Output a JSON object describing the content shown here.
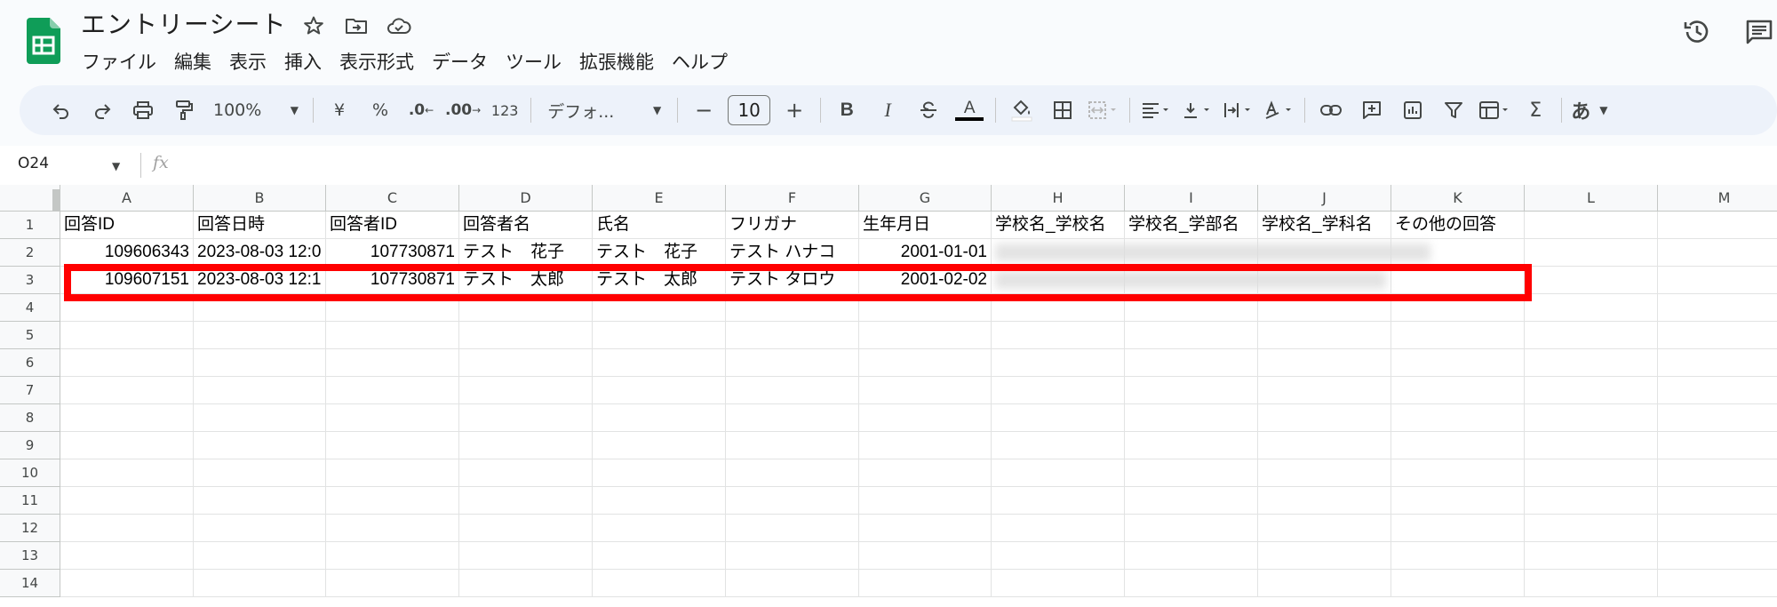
{
  "app": {
    "doc_title": "エントリーシート"
  },
  "menu": [
    "ファイル",
    "編集",
    "表示",
    "挿入",
    "表示形式",
    "データ",
    "ツール",
    "拡張機能",
    "ヘルプ"
  ],
  "toolbar": {
    "zoom": "100%",
    "currency": "¥",
    "percent": "%",
    "dec_decrease": ".0",
    "dec_increase": ".00",
    "number_format": "123",
    "font": "デフォ...",
    "font_size": "10",
    "minus": "−",
    "plus": "+",
    "bold": "B",
    "italic": "I",
    "text_color": "A",
    "input_tools": "あ",
    "sigma": "Σ"
  },
  "formula_bar": {
    "cell_ref": "O24",
    "fx": "fx",
    "content": ""
  },
  "grid": {
    "columns": [
      "A",
      "B",
      "C",
      "D",
      "E",
      "F",
      "G",
      "H",
      "I",
      "J",
      "K",
      "L",
      "M"
    ],
    "rows": [
      "1",
      "2",
      "3",
      "4",
      "5",
      "6",
      "7",
      "8",
      "9",
      "10",
      "11",
      "12",
      "13",
      "14"
    ],
    "header_row": [
      "回答ID",
      "回答日時",
      "回答者ID",
      "回答者名",
      "氏名",
      "フリガナ",
      "生年月日",
      "学校名_学校名",
      "学校名_学部名",
      "学校名_学科名",
      "その他の回答"
    ],
    "data_rows": [
      [
        "109606343",
        "2023-08-03 12:0",
        "107730871",
        "テスト　花子",
        "テスト　花子",
        "テスト ハナコ",
        "2001-01-01"
      ],
      [
        "109607151",
        "2023-08-03 12:1",
        "107730871",
        "テスト　太郎",
        "テスト　太郎",
        "テスト タロウ",
        "2001-02-02"
      ]
    ]
  },
  "colors": {
    "highlight": "#ff0000",
    "sheets_green": "#0f9d58",
    "toolbar_bg": "#edf2fa"
  }
}
